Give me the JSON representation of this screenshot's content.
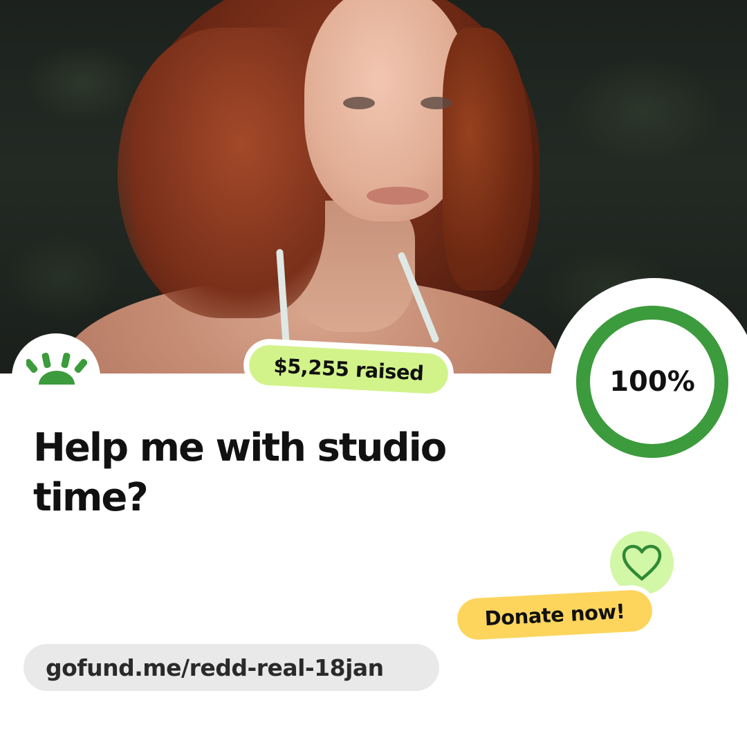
{
  "icons": {
    "logo": "gofundme-sunrise-logo",
    "heart": "heart-outline-icon"
  },
  "campaign": {
    "raised_text": "$5,255 raised",
    "progress_text": "100%",
    "progress_fraction": 1.0,
    "title": "Help me with studio time?",
    "donate_label": "Donate now!",
    "url": "gofund.me/redd-real-18jan"
  },
  "colors": {
    "brand_green": "#3c9b3c",
    "raised_badge": "#d2f38a",
    "heart_badge": "#d2f7a6",
    "donate_button": "#fdd55c",
    "url_pill": "#e9e9e9",
    "text": "#111111"
  }
}
